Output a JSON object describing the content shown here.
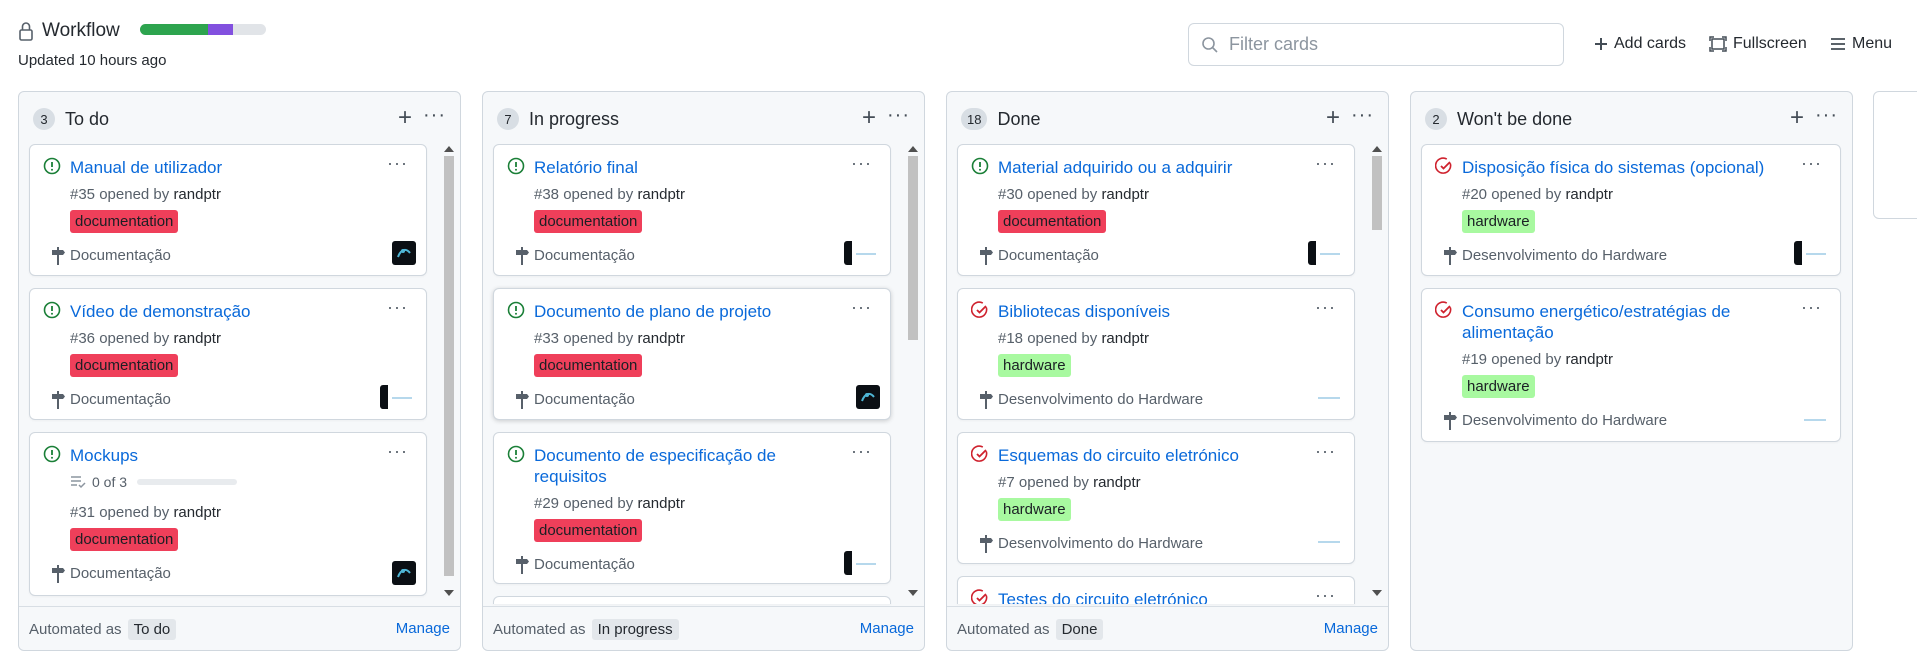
{
  "project": {
    "title": "Workflow",
    "updated": "Updated 10 hours ago",
    "progress": {
      "done_pct": 54,
      "in_progress_pct": 20
    }
  },
  "filter": {
    "placeholder": "Filter cards",
    "icon": "search-icon"
  },
  "toolbar": {
    "add_cards": "Add cards",
    "fullscreen": "Fullscreen",
    "menu": "Menu"
  },
  "colors": {
    "link": "#0969da",
    "open_green": "#1a7f37",
    "closed_red": "#cf222e",
    "label_documentation": "#ef3f5a",
    "label_hardware": "#a8f9a0",
    "progress_green": "#2da44e",
    "progress_purple": "#8250df"
  },
  "columns": [
    {
      "name": "To do",
      "count": "3",
      "automated_as": "Automated as",
      "automation": "To do",
      "manage": "Manage",
      "cards": [
        {
          "title": "Manual de utilizador",
          "number": "#35 opened by",
          "author": "randptr",
          "label": "documentation",
          "milestone": "Documentação",
          "state": "open"
        },
        {
          "title": "Vídeo de demonstração",
          "number": "#36 opened by",
          "author": "randptr",
          "label": "documentation",
          "milestone": "Documentação",
          "state": "open"
        },
        {
          "title": "Mockups",
          "checklist": "0 of 3",
          "number": "#31 opened by",
          "author": "randptr",
          "label": "documentation",
          "milestone": "Documentação",
          "state": "open"
        }
      ]
    },
    {
      "name": "In progress",
      "count": "7",
      "automated_as": "Automated as",
      "automation": "In progress",
      "manage": "Manage",
      "cards": [
        {
          "title": "Relatório final",
          "number": "#38 opened by",
          "author": "randptr",
          "label": "documentation",
          "milestone": "Documentação",
          "state": "open"
        },
        {
          "title": "Documento de plano de projeto",
          "number": "#33 opened by",
          "author": "randptr",
          "label": "documentation",
          "milestone": "Documentação",
          "state": "open"
        },
        {
          "title": "Documento de especificação de requisitos",
          "number": "#29 opened by",
          "author": "randptr",
          "label": "documentation",
          "milestone": "Documentação",
          "state": "open"
        }
      ]
    },
    {
      "name": "Done",
      "count": "18",
      "automated_as": "Automated as",
      "automation": "Done",
      "manage": "Manage",
      "cards": [
        {
          "title": "Material adquirido ou a adquirir",
          "number": "#30 opened by",
          "author": "randptr",
          "label": "documentation",
          "milestone": "Documentação",
          "state": "open"
        },
        {
          "title": "Bibliotecas disponíveis",
          "number": "#18 opened by",
          "author": "randptr",
          "label": "hardware",
          "milestone": "Desenvolvimento do Hardware",
          "state": "closed"
        },
        {
          "title": "Esquemas do circuito eletrónico",
          "number": "#7 opened by",
          "author": "randptr",
          "label": "hardware",
          "milestone": "Desenvolvimento do Hardware",
          "state": "closed"
        },
        {
          "title": "Testes do circuito eletrónico",
          "state": "closed"
        }
      ]
    },
    {
      "name": "Won't be done",
      "count": "2",
      "cards": [
        {
          "title": "Disposição física do sistemas (opcional)",
          "number": "#20 opened by",
          "author": "randptr",
          "label": "hardware",
          "milestone": "Desenvolvimento do Hardware",
          "state": "closed"
        },
        {
          "title": "Consumo energético/estratégias de alimentação",
          "number": "#19 opened by",
          "author": "randptr",
          "label": "hardware",
          "milestone": "Desenvolvimento do Hardware",
          "state": "closed"
        }
      ]
    }
  ]
}
